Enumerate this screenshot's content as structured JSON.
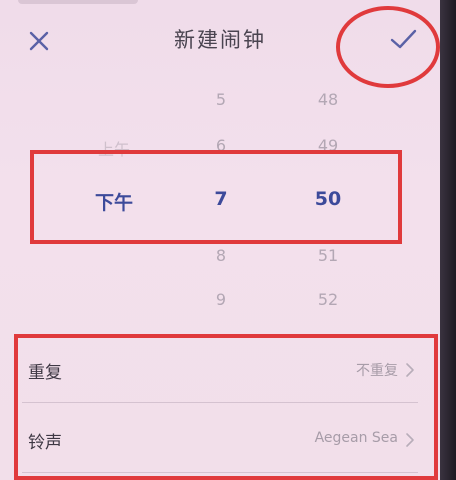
{
  "header": {
    "title": "新建闹钟",
    "close_icon": "close-icon",
    "confirm_icon": "checkmark-icon"
  },
  "picker": {
    "period": {
      "above": "上午",
      "selected": "下午"
    },
    "hour": {
      "above2": "5",
      "above1": "6",
      "selected": "7",
      "below1": "8",
      "below2": "9"
    },
    "minute": {
      "above2": "48",
      "above1": "49",
      "selected": "50",
      "below1": "51",
      "below2": "52"
    }
  },
  "settings": {
    "repeat": {
      "label": "重复",
      "value": "不重复"
    },
    "ringtone": {
      "label": "铃声",
      "value": "Aegean Sea"
    }
  },
  "colors": {
    "selected_text": "#3c4a9a",
    "accent": "#4f5aa8",
    "annotation": "#e03a3c",
    "background": "#f2deea"
  }
}
